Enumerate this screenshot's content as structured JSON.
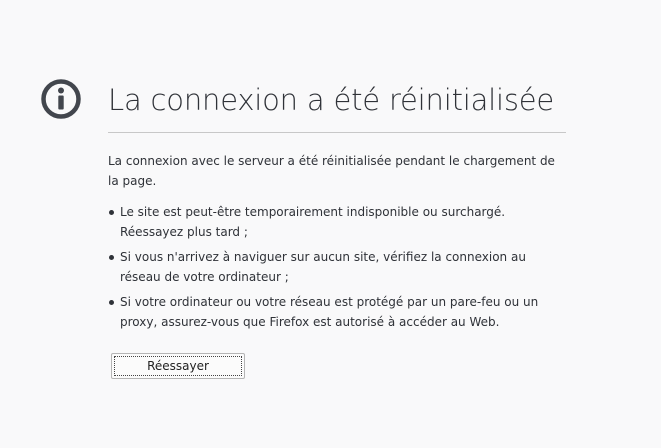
{
  "error": {
    "icon": "info-icon",
    "title": "La connexion a été réinitialisée",
    "description": "La connexion avec le serveur a été réinitialisée pendant le chargement de la page.",
    "suggestions": [
      "Le site est peut-être temporairement indisponible ou surchargé. Réessayez plus tard ;",
      "Si vous n'arrivez à naviguer sur aucun site, vérifiez la connexion au réseau de votre ordinateur ;",
      "Si votre ordinateur ou votre réseau est protégé par un pare-feu ou un proxy, assurez-vous que Firefox est autorisé à accéder au Web."
    ],
    "retry_label": "Réessayer"
  },
  "colors": {
    "background": "#f9f9fa",
    "icon": "#42464d",
    "text": "#2f3238",
    "divider": "#c8c8c8"
  }
}
